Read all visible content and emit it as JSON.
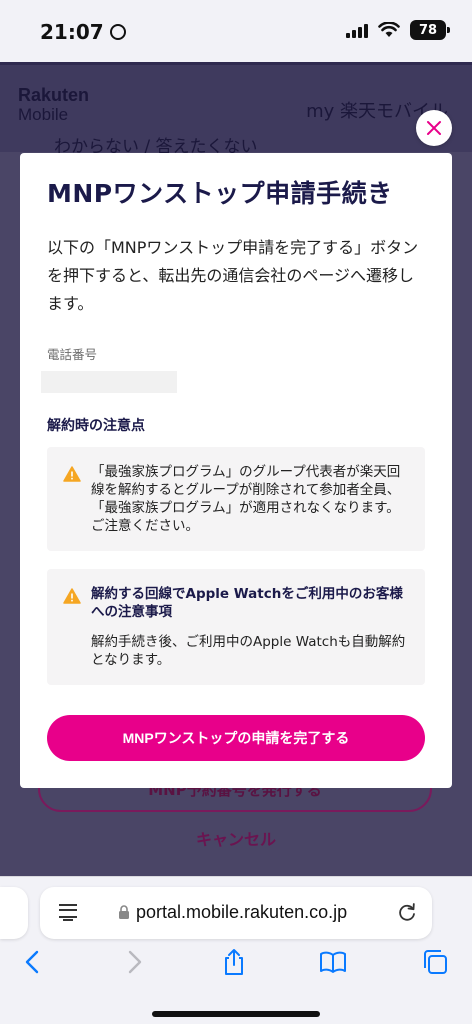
{
  "status_bar": {
    "time": "21:07",
    "battery": "78"
  },
  "background_page": {
    "logo_line1": "Rakuten",
    "logo_line2": "Mobile",
    "my_link": "my 楽天モバイル",
    "dropdown_value": "わからない / 答えたくない",
    "outline_button": "MNP予約番号を発行する",
    "cancel_link": "キャンセル"
  },
  "modal": {
    "title": "MNPワンストップ申請手続き",
    "description": "以下の「MNPワンストップ申請を完了する」ボタンを押下すると、転出先の通信会社のページへ遷移します。",
    "phone_label": "電話番号",
    "phone_value": "",
    "notes_title": "解約時の注意点",
    "notice1": "「最強家族プログラム」のグループ代表者が楽天回線を解約するとグループが削除されて参加者全員、「最強家族プログラム」が適用されなくなります。ご注意ください。",
    "notice2_head": "解約する回線でApple Watchをご利用中のお客様への注意事項",
    "notice2_body": "解約手続き後、ご利用中のApple Watchも自動解約となります。",
    "primary_button": "MNPワンストップの申請を完了する"
  },
  "browser": {
    "url": "portal.mobile.rakuten.co.jp"
  },
  "colors": {
    "accent": "#e8008a",
    "title": "#1b1a4a",
    "warning": "#f5a623",
    "overlay": "#4a4566"
  }
}
